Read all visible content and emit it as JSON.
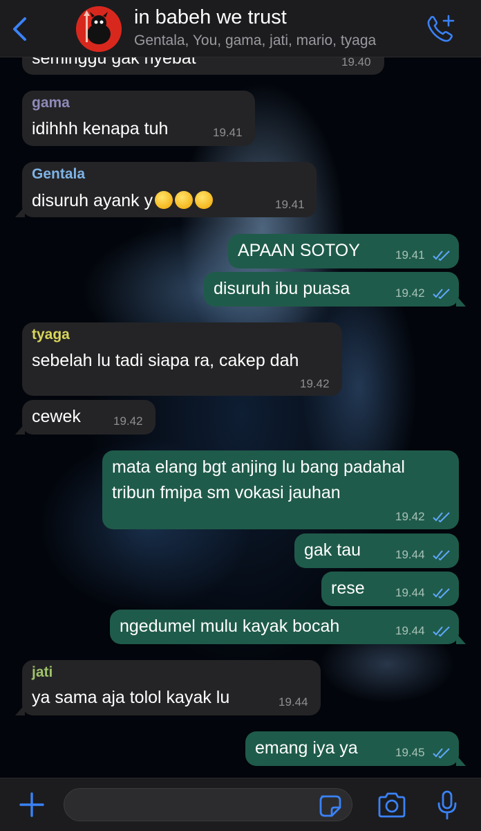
{
  "header": {
    "title": "in babeh we trust",
    "members": "Gentala, You, gama, jati, mario, tyaga"
  },
  "colors": {
    "accent": "#3a82f7",
    "incoming_bubble": "#242426",
    "outgoing_bubble": "#1f5b4a",
    "sender_gama": "#8e8ab8",
    "sender_gentala": "#7fb3e6",
    "sender_tyaga": "#d9d65a",
    "sender_jati": "#9fc26b",
    "read_ticks": "#5fa8ff"
  },
  "messages": [
    {
      "direction": "in",
      "sender": "",
      "text": "seminggu gak nyebat",
      "time": "19.40"
    },
    {
      "direction": "in",
      "sender": "gama",
      "text": "idihhh kenapa tuh",
      "time": "19.41"
    },
    {
      "direction": "in",
      "sender": "Gentala",
      "text": "disuruh ayank y",
      "emojis": [
        "rolling-on-floor-laughing",
        "grinning-sweat",
        "rolling-on-floor-laughing"
      ],
      "time": "19.41"
    },
    {
      "direction": "out",
      "text": "APAAN SOTOY",
      "time": "19.41",
      "read": true
    },
    {
      "direction": "out",
      "text": "disuruh ibu puasa",
      "time": "19.42",
      "read": true
    },
    {
      "direction": "in",
      "sender": "tyaga",
      "text": "sebelah lu tadi siapa ra, cakep dah",
      "time": "19.42"
    },
    {
      "direction": "in",
      "sender": "",
      "text": "cewek",
      "time": "19.42"
    },
    {
      "direction": "out",
      "text": "mata elang bgt anjing lu bang padahal",
      "text2": "tribun fmipa sm vokasi jauhan",
      "time": "19.42",
      "read": true
    },
    {
      "direction": "out",
      "text": "gak tau",
      "time": "19.44",
      "read": true
    },
    {
      "direction": "out",
      "text": "rese",
      "time": "19.44",
      "read": true
    },
    {
      "direction": "out",
      "text": "ngedumel mulu kayak bocah",
      "time": "19.44",
      "read": true
    },
    {
      "direction": "in",
      "sender": "jati",
      "text": "ya sama aja tolol kayak lu",
      "time": "19.44"
    },
    {
      "direction": "out",
      "text": "emang iya ya",
      "time": "19.45",
      "read": true
    }
  ],
  "composer": {
    "placeholder": "",
    "icons": [
      "plus-icon",
      "sticker-icon",
      "camera-icon",
      "microphone-icon"
    ]
  }
}
